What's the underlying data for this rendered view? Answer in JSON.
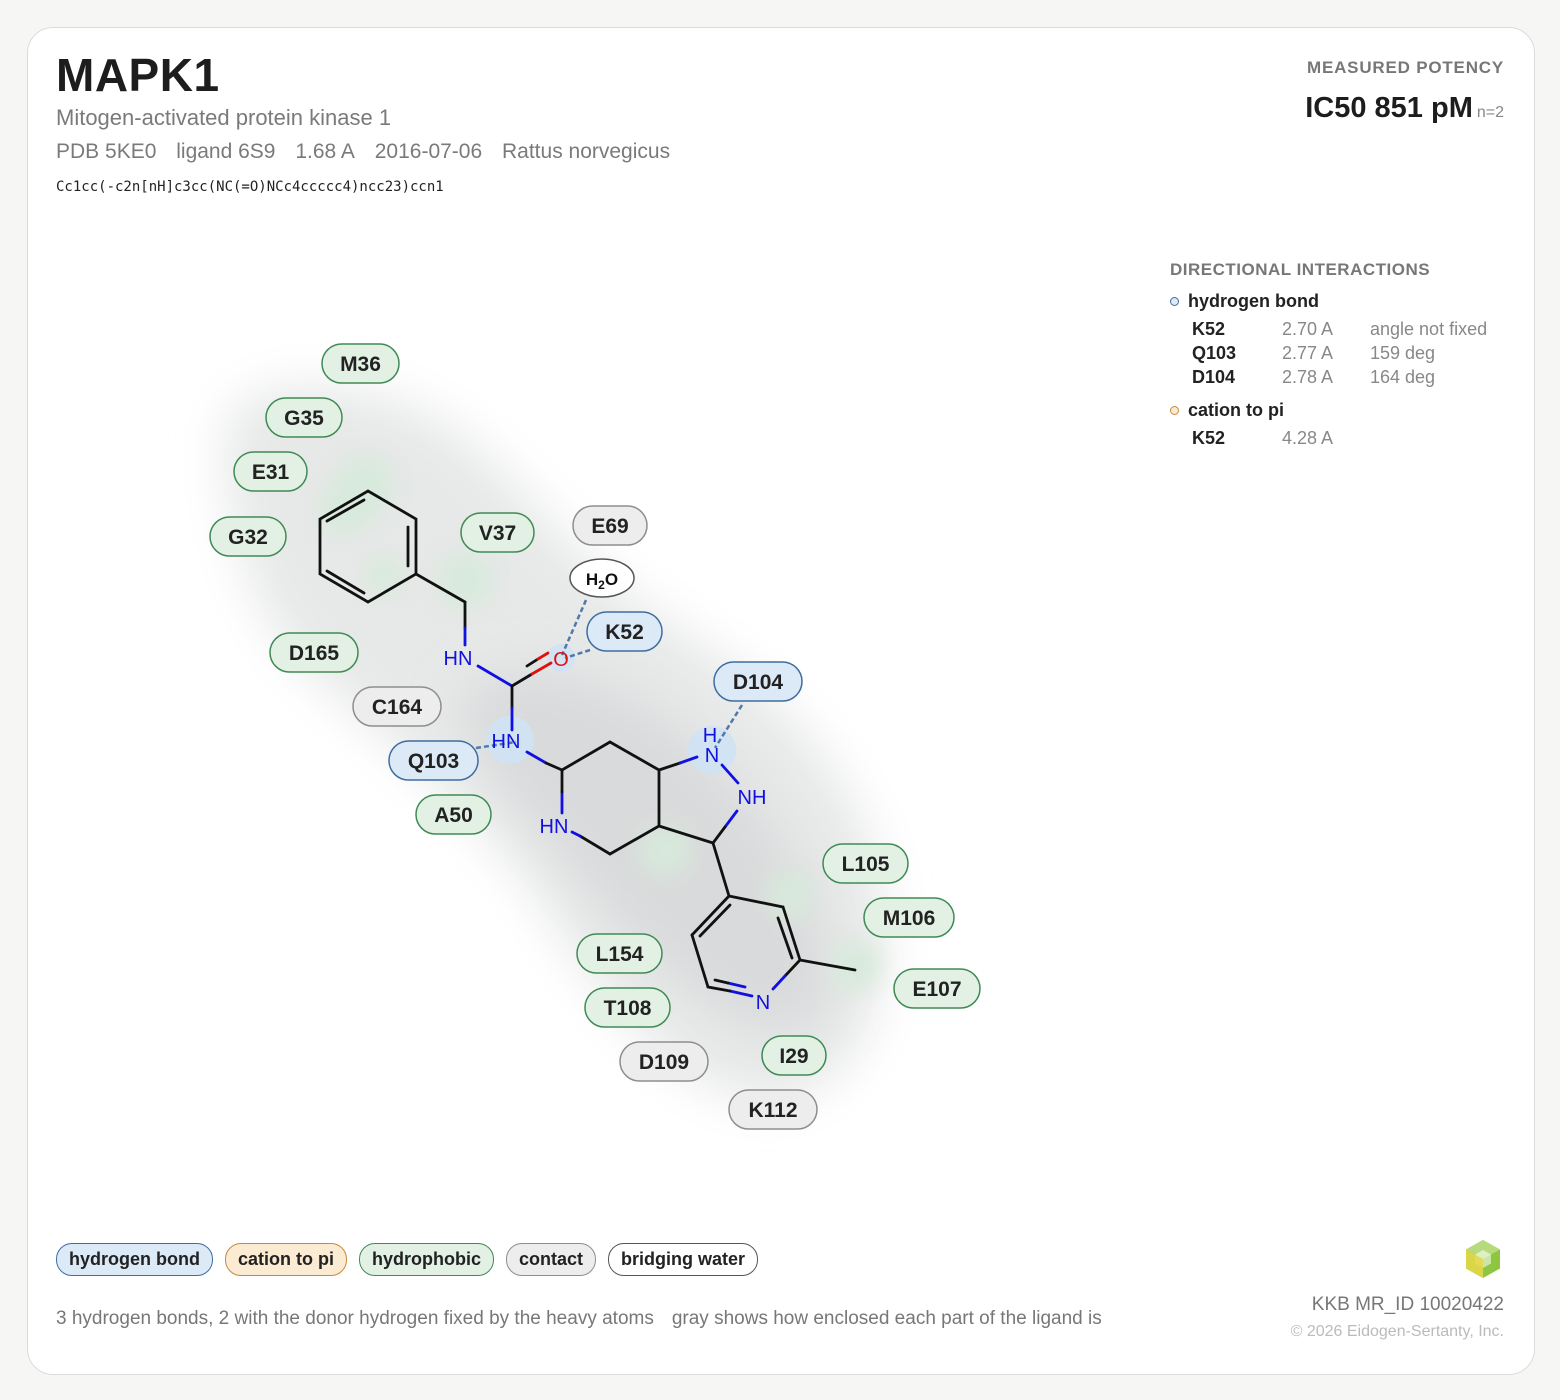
{
  "header": {
    "title": "MAPK1",
    "subtitle": "Mitogen-activated protein kinase 1",
    "pdb": "PDB 5KE0",
    "ligand": "ligand 6S9",
    "resolution": "1.68 A",
    "date": "2016-07-06",
    "organism": "Rattus norvegicus",
    "smiles": "Cc1cc(-c2n[nH]c3cc(NC(=O)NCc4ccccc4)ncc23)ccn1"
  },
  "potency": {
    "label": "MEASURED POTENCY",
    "value": "IC50 851 pM",
    "n": "n=2"
  },
  "interactions": {
    "title": "DIRECTIONAL INTERACTIONS",
    "hbond": {
      "label": "hydrogen bond",
      "rows": [
        {
          "res": "K52",
          "dist": "2.70 A",
          "angle": "angle not fixed"
        },
        {
          "res": "Q103",
          "dist": "2.77 A",
          "angle": "159 deg"
        },
        {
          "res": "D104",
          "dist": "2.78 A",
          "angle": "164 deg"
        }
      ]
    },
    "cation": {
      "label": "cation to pi",
      "rows": [
        {
          "res": "K52",
          "dist": "4.28 A"
        }
      ]
    }
  },
  "residues": {
    "M36": "M36",
    "G35": "G35",
    "E31": "E31",
    "G32": "G32",
    "V37": "V37",
    "E69": "E69",
    "K52": "K52",
    "D104": "D104",
    "D165": "D165",
    "C164": "C164",
    "Q103": "Q103",
    "A50": "A50",
    "L105": "L105",
    "M106": "M106",
    "E107": "E107",
    "L154": "L154",
    "T108": "T108",
    "D109": "D109",
    "I29": "I29",
    "K112": "K112"
  },
  "atoms": {
    "hn1": "HN",
    "hn2": "HN",
    "o": "O",
    "hn_ring": "HN",
    "nh": "NH",
    "h": "H",
    "n_pyr": "N",
    "water_h": "H",
    "water_sub": "2",
    "water_o": "O"
  },
  "legend": {
    "hbond": "hydrogen bond",
    "cation": "cation to pi",
    "hydrophobic": "hydrophobic",
    "contact": "contact",
    "water": "bridging water"
  },
  "footer": {
    "note1": "3 hydrogen bonds, 2 with the donor hydrogen fixed by the heavy atoms",
    "note2": "gray shows how enclosed each part of the ligand is",
    "id": "KKB MR_ID 10020422",
    "copyright": "© 2026 Eidogen-Sertanty, Inc."
  },
  "colors": {
    "hbond_fill": "#dce9f7",
    "hbond_border": "#3f6d9e",
    "cation_fill": "#fcebd3",
    "cation_border": "#c8893a",
    "hydrophobic_fill": "#e2f1e4",
    "hydrophobic_border": "#3f8a55",
    "contact_fill": "#ededed",
    "contact_border": "#8e8e8e",
    "water_fill": "#ffffff",
    "water_border": "#555555",
    "nitrogen": "#1010e0",
    "oxygen": "#e01010",
    "logo": "#8dc63f"
  }
}
